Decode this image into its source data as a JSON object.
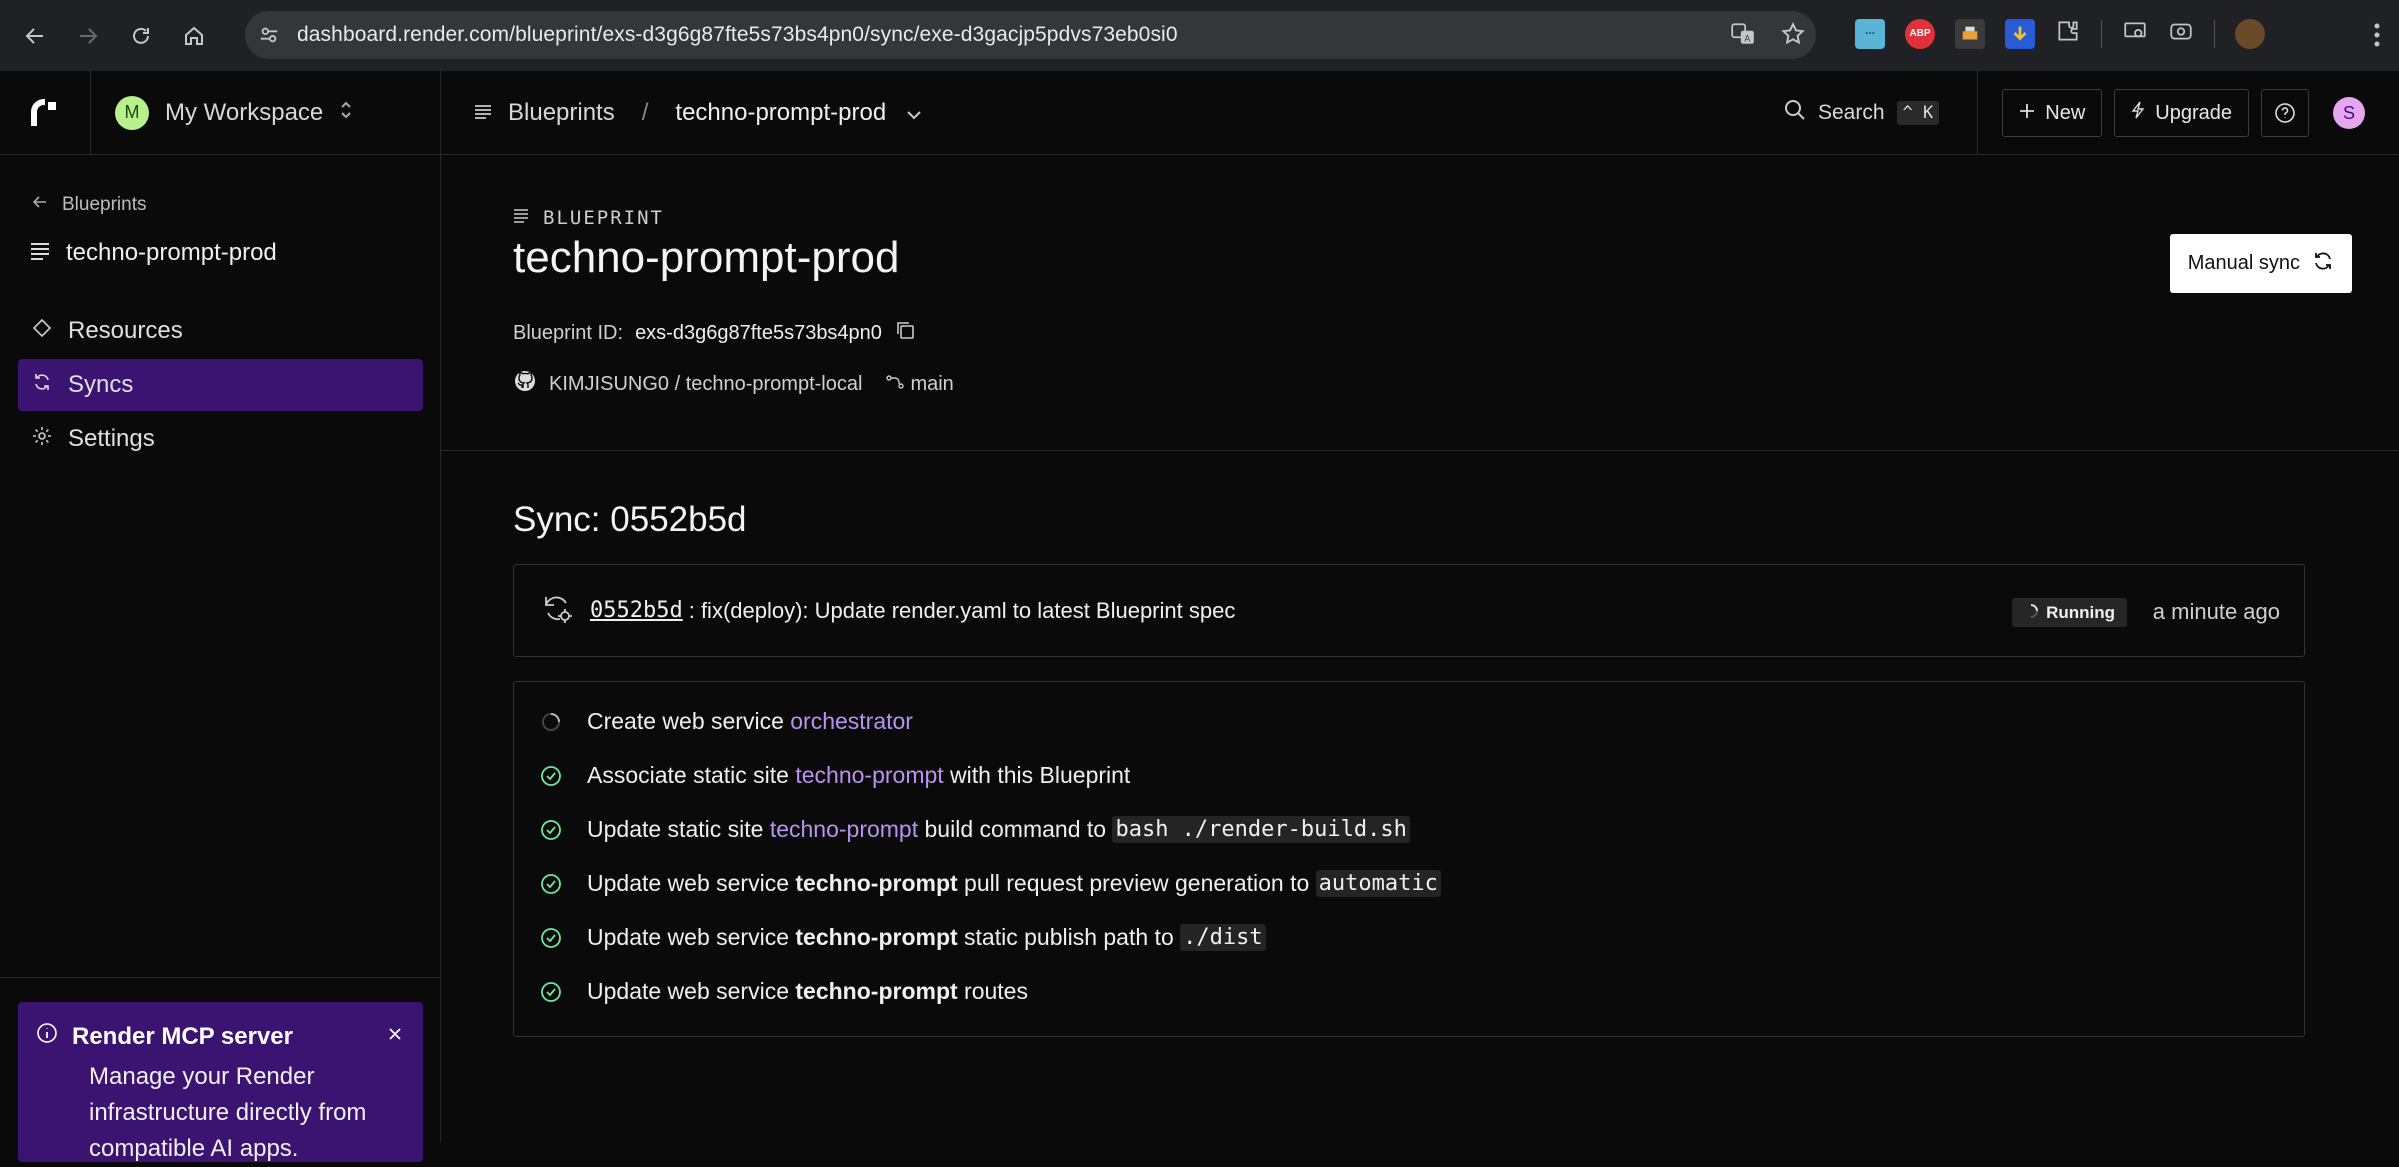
{
  "browser": {
    "url": "dashboard.render.com/blueprint/exs-d3g6g87fte5s73bs4pn0/sync/exe-d3gacjp5pdvs73eb0si0",
    "ext_abp": "ABP"
  },
  "sidebar": {
    "workspace_initial": "M",
    "workspace_name": "My Workspace",
    "back_label": "Blueprints",
    "blueprint_name": "techno-prompt-prod",
    "items": [
      {
        "label": "Resources"
      },
      {
        "label": "Syncs"
      },
      {
        "label": "Settings"
      }
    ],
    "mcp": {
      "title": "Render MCP server",
      "desc": "Manage your Render infrastructure directly from compatible AI apps."
    }
  },
  "header": {
    "crumb_blueprints": "Blueprints",
    "crumb_sep": "/",
    "crumb_current": "techno-prompt-prod",
    "search_label": "Search",
    "search_kbd": "^ K",
    "new_label": "New",
    "upgrade_label": "Upgrade",
    "user_initial": "S"
  },
  "blueprint": {
    "label": "BLUEPRINT",
    "title": "techno-prompt-prod",
    "id_label": "Blueprint ID:",
    "id_value": "exs-d3g6g87fte5s73bs4pn0",
    "repo": "KIMJISUNG0 / techno-prompt-local",
    "branch": "main",
    "manual_sync": "Manual sync"
  },
  "sync": {
    "title": "Sync: 0552b5d",
    "commit_hash": "0552b5d",
    "commit_msg": ": fix(deploy): Update render.yaml to latest Blueprint spec",
    "status": "Running",
    "time": "a minute ago",
    "actions": [
      {
        "status": "pending",
        "pre": "Create web service ",
        "link": "orchestrator"
      },
      {
        "status": "done",
        "pre": "Associate static site ",
        "link": "techno-prompt",
        "post": " with this Blueprint"
      },
      {
        "status": "done",
        "pre": "Update static site ",
        "link": "techno-prompt",
        "post": " build command to ",
        "code": "bash ./render-build.sh"
      },
      {
        "status": "done",
        "pre": "Update web service ",
        "bold": "techno-prompt",
        "post": " pull request preview generation to ",
        "code": "automatic"
      },
      {
        "status": "done",
        "pre": "Update web service ",
        "bold": "techno-prompt",
        "post": " static publish path to ",
        "code": "./dist"
      },
      {
        "status": "done",
        "pre": "Update web service ",
        "bold": "techno-prompt",
        "post": " routes"
      }
    ]
  },
  "colors": {
    "accent_purple": "#3a1470",
    "link_purple": "#b893f0",
    "check_green": "#6ee7a0",
    "workspace_avatar": "#b8f08b",
    "user_avatar": "#e7a6f0"
  },
  "icons": [
    "back-icon",
    "forward-icon",
    "reload-icon",
    "home-icon",
    "site-settings-icon",
    "translate-icon",
    "star-icon",
    "extensions-icon",
    "render-logo-icon",
    "blueprint-icon",
    "diamond-icon",
    "sync-icon",
    "gear-icon",
    "info-icon",
    "close-icon",
    "search-icon",
    "plus-icon",
    "bolt-icon",
    "help-icon",
    "copy-icon",
    "github-icon",
    "branch-icon",
    "spinner-icon",
    "check-circle-icon"
  ]
}
